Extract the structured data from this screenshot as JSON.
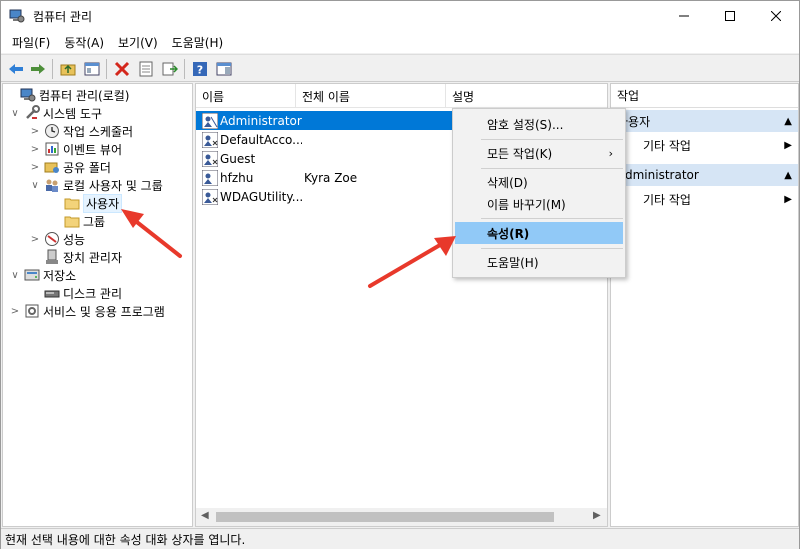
{
  "window": {
    "title": "컴퓨터 관리"
  },
  "menubar": [
    "파일(F)",
    "동작(A)",
    "보기(V)",
    "도움말(H)"
  ],
  "tree": [
    {
      "label": "컴퓨터 관리(로컬)",
      "icon": "computer-management-icon",
      "expander": ""
    },
    {
      "label": "시스템 도구",
      "icon": "tools-icon",
      "expander": "∨"
    },
    {
      "label": "작업 스케줄러",
      "icon": "clock-icon",
      "expander": ">"
    },
    {
      "label": "이벤트 뷰어",
      "icon": "event-viewer-icon",
      "expander": ">"
    },
    {
      "label": "공유 폴더",
      "icon": "shared-folder-icon",
      "expander": ">"
    },
    {
      "label": "로컬 사용자 및 그룹",
      "icon": "users-group-icon",
      "expander": "∨"
    },
    {
      "label": "사용자",
      "icon": "folder-icon",
      "expander": ""
    },
    {
      "label": "그룹",
      "icon": "folder-icon",
      "expander": ""
    },
    {
      "label": "성능",
      "icon": "performance-icon",
      "expander": ">"
    },
    {
      "label": "장치 관리자",
      "icon": "device-manager-icon",
      "expander": ""
    },
    {
      "label": "저장소",
      "icon": "storage-icon",
      "expander": "∨"
    },
    {
      "label": "디스크 관리",
      "icon": "disk-icon",
      "expander": ""
    },
    {
      "label": "서비스 및 응용 프로그램",
      "icon": "services-icon",
      "expander": ">"
    }
  ],
  "list": {
    "columns": [
      "이름",
      "전체 이름",
      "설명"
    ],
    "rows": [
      {
        "name": "Administrator",
        "full_name": ""
      },
      {
        "name": "DefaultAcco...",
        "full_name": ""
      },
      {
        "name": "Guest",
        "full_name": ""
      },
      {
        "name": "hfzhu",
        "full_name": "Kyra Zoe"
      },
      {
        "name": "WDAGUtility...",
        "full_name": ""
      }
    ]
  },
  "actions": {
    "header": "작업",
    "section1": "사용자",
    "section1_item": "기타 작업",
    "section2": "Administrator",
    "section2_item": "기타 작업"
  },
  "context_menu": {
    "set_password": "암호 설정(S)...",
    "all_tasks": "모든 작업(K)",
    "delete": "삭제(D)",
    "rename": "이름 바꾸기(M)",
    "properties": "속성(R)",
    "help": "도움말(H)"
  },
  "statusbar": "현재 선택 내용에 대한 속성 대화 상자를 엽니다.",
  "colors": {
    "selection": "#0078d7",
    "menu_hover": "#91c9f7",
    "section_bg": "#d6e5f5",
    "annotation": "#e8392b"
  }
}
